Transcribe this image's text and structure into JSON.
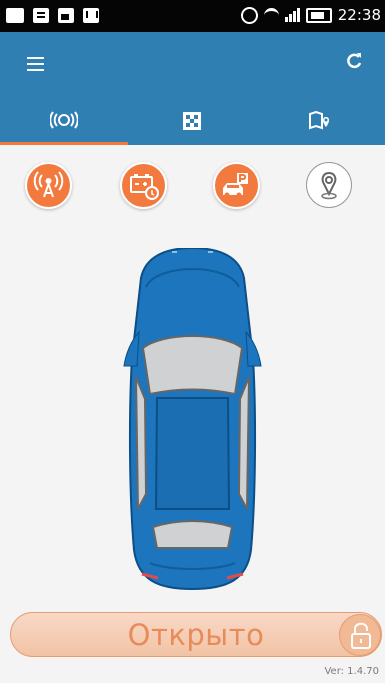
{
  "status_bar": {
    "time": "22:38",
    "left_icons": [
      "arrow-icon",
      "message-icon",
      "image-icon",
      "mail-icon"
    ],
    "right_icons": [
      "alarm-icon",
      "wifi-icon",
      "signal-icon",
      "battery-icon"
    ]
  },
  "header": {
    "menu_icon": "menu-icon",
    "refresh_icon": "refresh-icon",
    "tabs": [
      {
        "icon": "remote-alarm-icon",
        "active": true
      },
      {
        "icon": "grid-calendar-icon",
        "active": false
      },
      {
        "icon": "map-location-icon",
        "active": false
      }
    ]
  },
  "actions": [
    {
      "icon": "signal-tower-icon"
    },
    {
      "icon": "battery-charge-icon"
    },
    {
      "icon": "car-parking-icon"
    },
    {
      "icon": "location-pin-icon"
    }
  ],
  "colors": {
    "header": "#2f7fb2",
    "accent": "#f37a3f",
    "car": "#1d75bd",
    "unlock_text": "#e88b5b"
  },
  "unlock": {
    "label": "Открыто",
    "lock_icon": "lock-icon"
  },
  "version": "Ver: 1.4.70"
}
